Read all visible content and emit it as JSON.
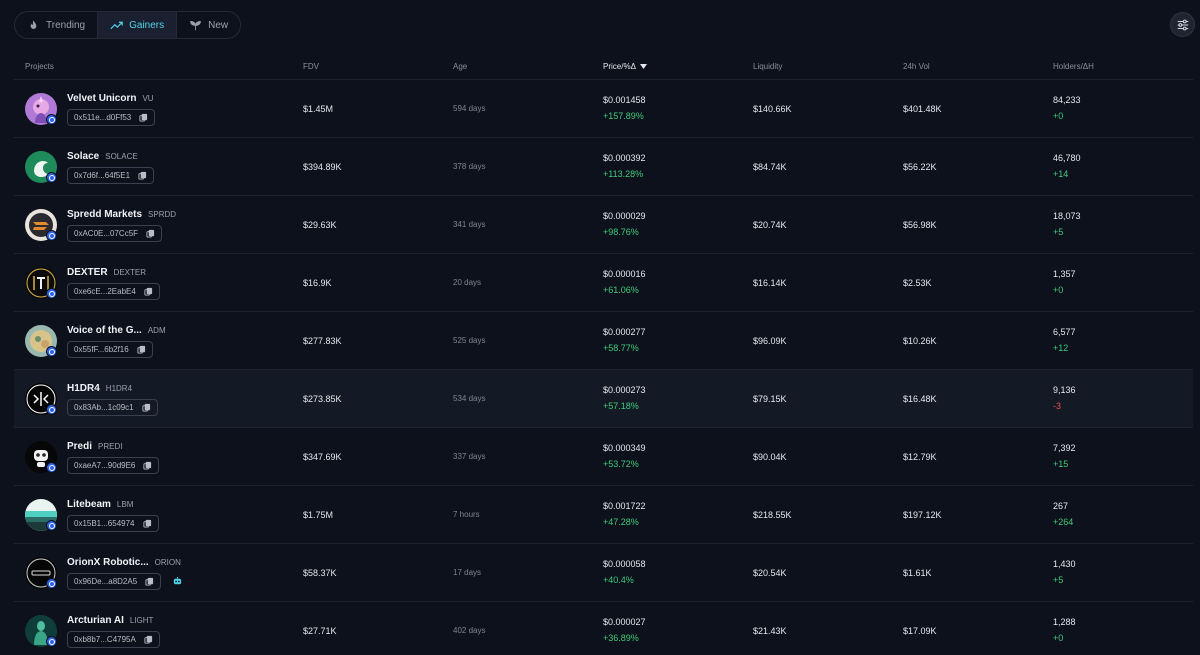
{
  "tabs": [
    {
      "label": "Trending",
      "icon": "flame-icon"
    },
    {
      "label": "Gainers",
      "icon": "trending-up-icon",
      "active": true
    },
    {
      "label": "New",
      "icon": "sprout-icon"
    }
  ],
  "headers": {
    "projects": "Projects",
    "fdv": "FDV",
    "age": "Age",
    "price": "Price/%Δ",
    "liquidity": "Liquidity",
    "vol": "24h Vol",
    "holders": "Holders/ΔH"
  },
  "colors": {
    "accent": "#4fd2e8",
    "positive": "#3fcb7a",
    "negative": "#ef4d4d",
    "background": "#0d111b"
  },
  "rows": [
    {
      "name": "Velvet Unicorn",
      "symbol": "VU",
      "address": "0x511e...d0Ff53",
      "fdv": "$1.45M",
      "age": "594 days",
      "price": "$0.001458",
      "pct": "+157.89%",
      "liquidity": "$140.66K",
      "vol": "$401.48K",
      "holders": "84,233",
      "delta_h": "+0"
    },
    {
      "name": "Solace",
      "symbol": "SOLACE",
      "address": "0x7d6f...64f5E1",
      "fdv": "$394.89K",
      "age": "378 days",
      "price": "$0.000392",
      "pct": "+113.28%",
      "liquidity": "$84.74K",
      "vol": "$56.22K",
      "holders": "46,780",
      "delta_h": "+14"
    },
    {
      "name": "Spredd Markets",
      "symbol": "SPRDD",
      "address": "0xAC0E...07Cc5F",
      "fdv": "$29.63K",
      "age": "341 days",
      "price": "$0.000029",
      "pct": "+98.76%",
      "liquidity": "$20.74K",
      "vol": "$56.98K",
      "holders": "18,073",
      "delta_h": "+5"
    },
    {
      "name": "DEXTER",
      "symbol": "DEXTER",
      "address": "0xe6cE...2EabE4",
      "fdv": "$16.9K",
      "age": "20 days",
      "price": "$0.000016",
      "pct": "+61.06%",
      "liquidity": "$16.14K",
      "vol": "$2.53K",
      "holders": "1,357",
      "delta_h": "+0"
    },
    {
      "name": "Voice of the G...",
      "symbol": "ADM",
      "address": "0x55fF...6b2f16",
      "fdv": "$277.83K",
      "age": "525 days",
      "price": "$0.000277",
      "pct": "+58.77%",
      "liquidity": "$96.09K",
      "vol": "$10.26K",
      "holders": "6,577",
      "delta_h": "+12"
    },
    {
      "name": "H1DR4",
      "symbol": "H1DR4",
      "address": "0x83Ab...1c09c1",
      "fdv": "$273.85K",
      "age": "534 days",
      "price": "$0.000273",
      "pct": "+57.18%",
      "liquidity": "$79.15K",
      "vol": "$16.48K",
      "holders": "9,136",
      "delta_h": "-3"
    },
    {
      "name": "Predi",
      "symbol": "PREDI",
      "address": "0xaeA7...90d9E6",
      "fdv": "$347.69K",
      "age": "337 days",
      "price": "$0.000349",
      "pct": "+53.72%",
      "liquidity": "$90.04K",
      "vol": "$12.79K",
      "holders": "7,392",
      "delta_h": "+15"
    },
    {
      "name": "Litebeam",
      "symbol": "LBM",
      "address": "0x15B1...654974",
      "fdv": "$1.75M",
      "age": "7 hours",
      "price": "$0.001722",
      "pct": "+47.28%",
      "liquidity": "$218.55K",
      "vol": "$197.12K",
      "holders": "267",
      "delta_h": "+264"
    },
    {
      "name": "OrionX Robotic...",
      "symbol": "ORION",
      "address": "0x96De...a8D2A5",
      "fdv": "$58.37K",
      "age": "17 days",
      "price": "$0.000058",
      "pct": "+40.4%",
      "liquidity": "$20.54K",
      "vol": "$1.61K",
      "holders": "1,430",
      "delta_h": "+5"
    },
    {
      "name": "Arcturian AI",
      "symbol": "LIGHT",
      "address": "0xb8b7...C4795A",
      "fdv": "$27.71K",
      "age": "402 days",
      "price": "$0.000027",
      "pct": "+36.89%",
      "liquidity": "$21.43K",
      "vol": "$17.09K",
      "holders": "1,288",
      "delta_h": "+0"
    }
  ]
}
